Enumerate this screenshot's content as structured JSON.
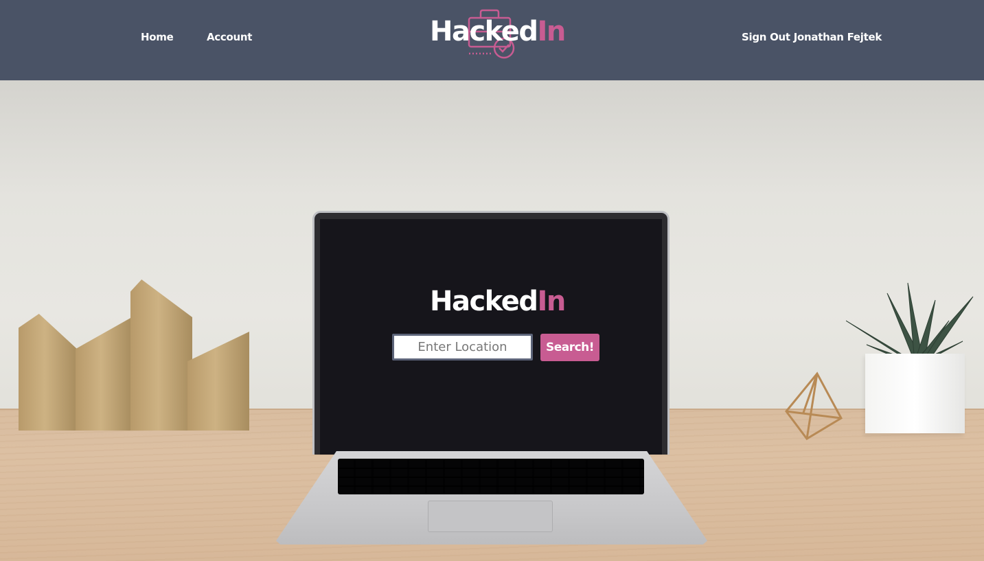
{
  "nav": {
    "home_label": "Home",
    "account_label": "Account",
    "signout_label": "Sign Out Jonathan Fejtek"
  },
  "brand": {
    "name_part1": "Hacked",
    "name_part2": "In",
    "icon": "briefcase-check-icon"
  },
  "hero": {
    "title_part1": "Hacked",
    "title_part2": "In",
    "location_placeholder": "Enter Location",
    "location_value": "",
    "search_label": "Search!"
  },
  "colors": {
    "navbar_bg": "#4a5366",
    "accent_pink": "#c85c92",
    "text_white": "#ffffff"
  }
}
